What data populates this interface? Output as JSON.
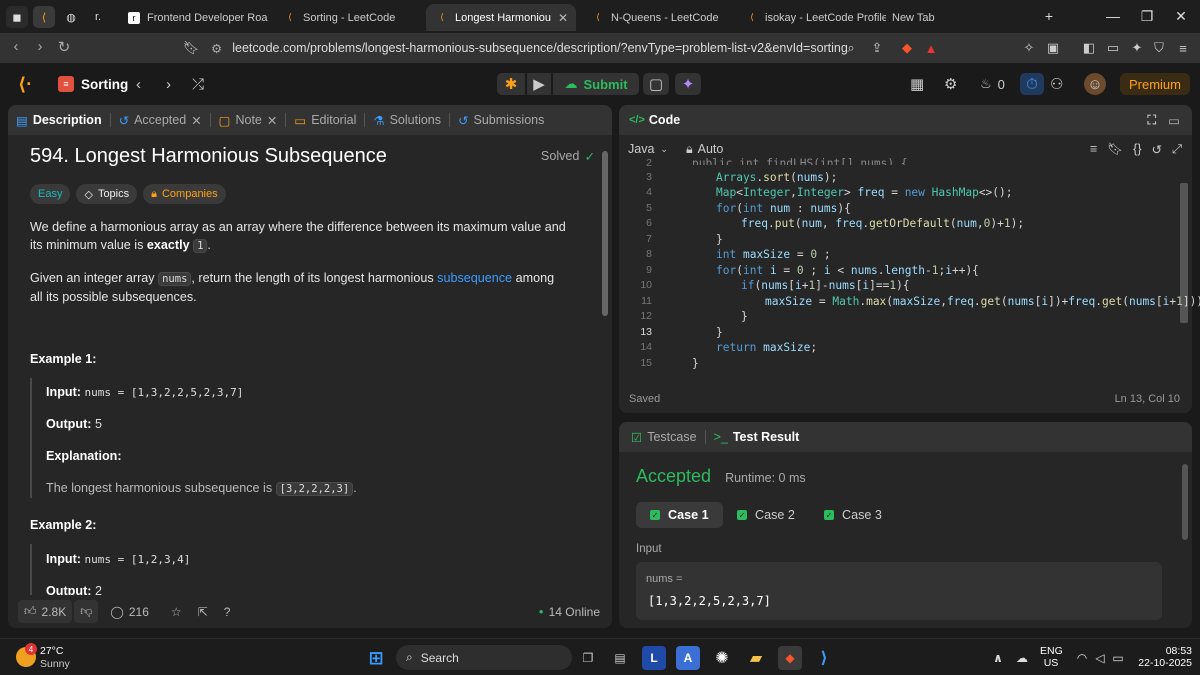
{
  "browser": {
    "tabs": [
      {
        "title": "Frontend Developer Roadm"
      },
      {
        "title": "Sorting - LeetCode"
      },
      {
        "title": "Longest Harmonious Su"
      },
      {
        "title": "N-Queens - LeetCode"
      },
      {
        "title": "isokay - LeetCode Profile"
      },
      {
        "title": "New Tab"
      }
    ],
    "url": "leetcode.com/problems/longest-harmonious-subsequence/description/?envType=problem-list-v2&envId=sorting"
  },
  "header": {
    "list_name": "Sorting",
    "submit_label": "Submit",
    "streak_count": "0",
    "premium_label": "Premium"
  },
  "description_panel": {
    "tabs": [
      "Description",
      "Accepted",
      "Note",
      "Editorial",
      "Solutions",
      "Submissions"
    ],
    "title": "594. Longest Harmonious Subsequence",
    "solved_label": "Solved",
    "tags": [
      "Easy",
      "Topics",
      "Companies"
    ],
    "para1_a": "We define a harmonious array as an array where the difference between its maximum value and its minimum value is",
    "para1_bold": "exactly",
    "para1_code": "1",
    "para2_a": "Given an integer array",
    "para2_code": "nums",
    "para2_b": ", return the length of its longest harmonious",
    "para2_link": "subsequence",
    "para2_c": "among all its possible subsequences.",
    "example1": {
      "heading": "Example 1:",
      "input_label": "Input:",
      "input_value": "nums = [1,3,2,2,5,2,3,7]",
      "output_label": "Output:",
      "output_value": "5",
      "explanation_label": "Explanation:",
      "explanation_text": "The longest harmonious subsequence is",
      "explanation_code": "[3,2,2,2,3]"
    },
    "example2": {
      "heading": "Example 2:",
      "input_label": "Input:",
      "input_value": "nums = [1,2,3,4]",
      "output_label": "Output:",
      "output_value": "2"
    },
    "footer": {
      "likes": "2.8K",
      "comments": "216",
      "online": "14 Online"
    }
  },
  "code_panel": {
    "title": "Code",
    "language": "Java",
    "mode": "Auto",
    "line_numbers": [
      "2",
      "3",
      "4",
      "5",
      "6",
      "7",
      "8",
      "9",
      "10",
      "11",
      "12",
      "13",
      "14",
      "15"
    ],
    "saved_label": "Saved",
    "cursor": "Ln 13, Col 10"
  },
  "result_panel": {
    "tab_testcase": "Testcase",
    "tab_result": "Test Result",
    "status": "Accepted",
    "runtime": "Runtime: 0 ms",
    "cases": [
      "Case 1",
      "Case 2",
      "Case 3"
    ],
    "input_label": "Input",
    "var_label": "nums =",
    "var_value": "[1,3,2,2,5,2,3,7]"
  },
  "taskbar": {
    "weather_temp": "27°C",
    "weather_desc": "Sunny",
    "weather_badge": "4",
    "search_label": "Search",
    "lang_line1": "ENG",
    "lang_line2": "US",
    "time": "08:53",
    "date": "22-10-2025"
  },
  "colors": {
    "accent_orange": "#ffa116",
    "accepted_green": "#2cbb5d",
    "link_blue": "#3b9cff"
  }
}
